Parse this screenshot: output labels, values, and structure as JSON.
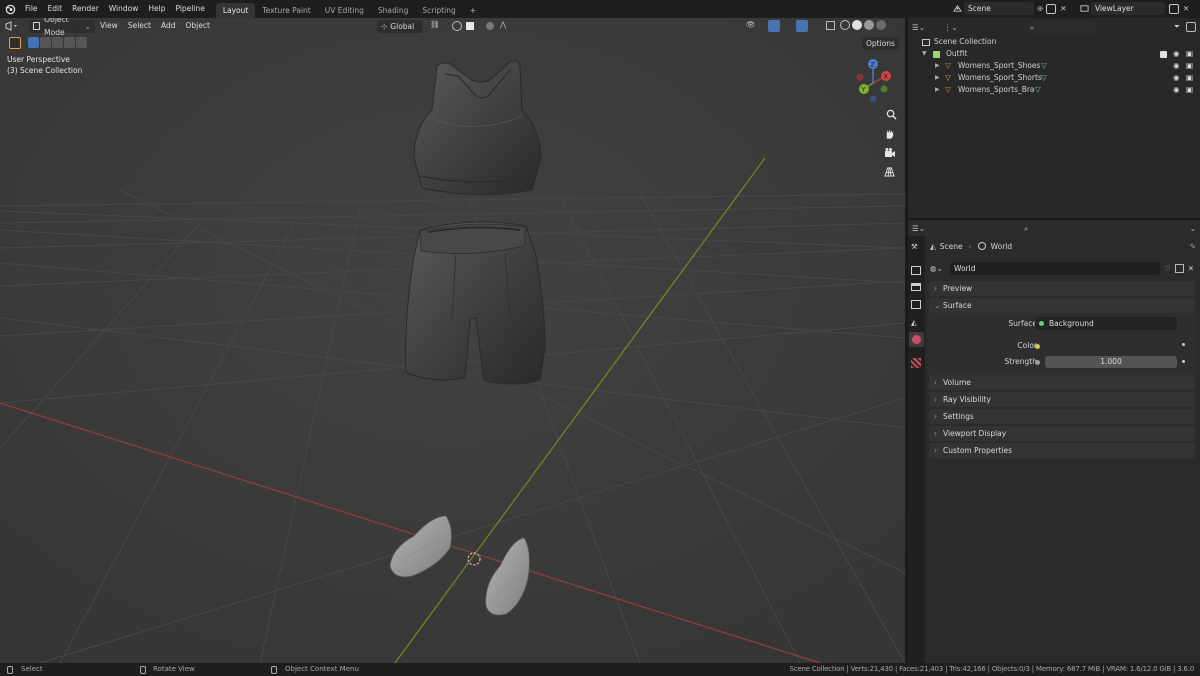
{
  "menu": {
    "file": "File",
    "edit": "Edit",
    "render": "Render",
    "window": "Window",
    "help": "Help",
    "pipeline": "Pipeline"
  },
  "workspaces": [
    "Layout",
    "Texture Paint",
    "UV Editing",
    "Shading",
    "Scripting"
  ],
  "add_workspace": "+",
  "scene_field": "Scene",
  "viewlayer_field": "ViewLayer",
  "viewport": {
    "mode": "Object Mode",
    "menu_view": "View",
    "menu_select": "Select",
    "menu_add": "Add",
    "menu_object": "Object",
    "transform_orientation": "Global",
    "options": "Options",
    "perspective_label": "User Perspective",
    "collection_label": "(3) Scene Collection",
    "gizmo": {
      "x": "X",
      "y": "Y",
      "z": "Z"
    }
  },
  "outliner": {
    "root": "Scene Collection",
    "collection": "Outfit",
    "objects": [
      "Womens_Sport_Shoes",
      "Womens_Sport_Shorts",
      "Womens_Sports_Bra"
    ]
  },
  "properties": {
    "breadcrumb_scene": "Scene",
    "breadcrumb_world": "World",
    "world_name": "World",
    "panels": {
      "preview": "Preview",
      "surface": "Surface",
      "volume": "Volume",
      "ray_visibility": "Ray Visibility",
      "settings": "Settings",
      "viewport_display": "Viewport Display",
      "custom_properties": "Custom Properties"
    },
    "surface_label": "Surface",
    "surface_value": "Background",
    "color_label": "Color",
    "strength_label": "Strength",
    "strength_value": "1.000"
  },
  "statusbar": {
    "select": "Select",
    "rotate": "Rotate View",
    "context": "Object Context Menu",
    "stats": "Scene Collection | Verts:21,430 | Faces:21,403 | Tris:42,166 | Objects:0/3 | Memory: 687.7 MiB | VRAM: 1.6/12.0 GiB | 3.6.0"
  },
  "colors": {
    "accent_blue": "#4772b3",
    "axis_red": "#b33f3f",
    "axis_green": "#6e9a1e",
    "grid": "#4a4a4a",
    "viewport_bg": "#3c3c3c",
    "object_orange": "#e8953a",
    "mesh_green": "#5fd18a",
    "collection_green": "#9fd36b"
  },
  "icons": [
    "blender-logo-icon",
    "editor-type-icon",
    "eye-icon",
    "search-icon",
    "zoom-icon",
    "hand-icon",
    "camera-icon",
    "grid-icon",
    "world-icon",
    "pin-icon",
    "close-icon"
  ]
}
